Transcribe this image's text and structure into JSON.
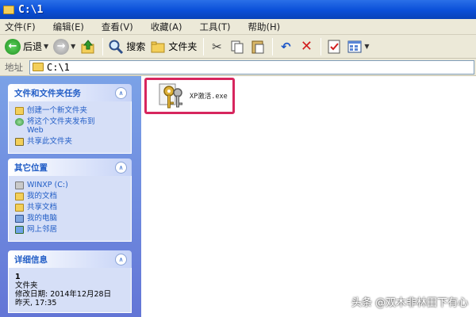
{
  "window": {
    "title": "C:\\1"
  },
  "menu": [
    "文件(F)",
    "编辑(E)",
    "查看(V)",
    "收藏(A)",
    "工具(T)",
    "帮助(H)"
  ],
  "toolbar": {
    "back": "后退",
    "search": "搜索",
    "folders": "文件夹"
  },
  "address": {
    "label": "地址",
    "value": "C:\\1"
  },
  "tasks": {
    "title": "文件和文件夹任务",
    "items": [
      "创建一个新文件夹",
      "将这个文件夹发布到\nWeb",
      "共享此文件夹"
    ]
  },
  "places": {
    "title": "其它位置",
    "items": [
      "WINXP (C:)",
      "我的文档",
      "共享文档",
      "我的电脑",
      "网上邻居"
    ]
  },
  "details": {
    "title": "详细信息",
    "name": "1",
    "type": "文件夹",
    "modified_label": "修改日期: 2014年12月28日",
    "modified_time": "昨天, 17:35"
  },
  "file": {
    "name": "XP激活.exe"
  },
  "watermark": "头条 @双木非林田下有心"
}
